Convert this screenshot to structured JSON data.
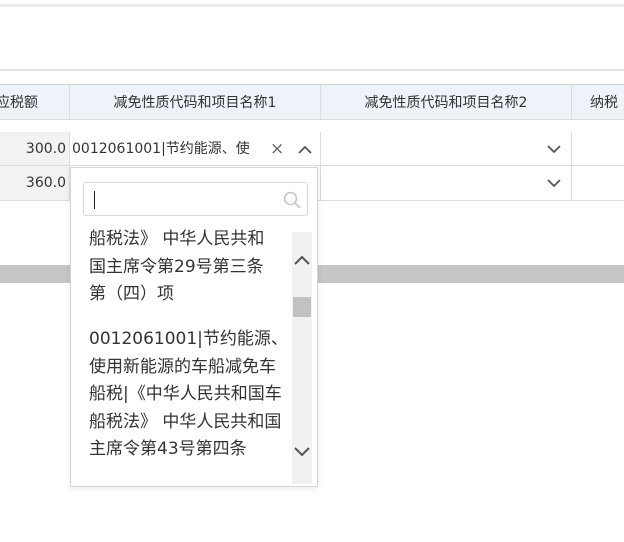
{
  "table": {
    "columns": [
      {
        "label": "应税额"
      },
      {
        "label": "减免性质代码和项目名称1"
      },
      {
        "label": "减免性质代码和项目名称2"
      },
      {
        "label": "纳税"
      }
    ],
    "rows": [
      {
        "amount": "300.0",
        "code1": "0012061001|节约能源、使",
        "code2": ""
      },
      {
        "amount": "360.0",
        "code1": "",
        "code2": ""
      }
    ]
  },
  "dropdown": {
    "search_value": "",
    "options": [
      "船税法》 中华人民共和国主席令第29号第三条第（四）项",
      "0012061001|节约能源、使用新能源的车船减免车船税|《中华人民共和国车船税法》 中华人民共和国主席令第43号第四条"
    ]
  },
  "icons": {
    "clear": "close-icon",
    "collapse": "chevron-up-icon",
    "expand": "chevron-down-icon",
    "search": "search-icon"
  }
}
